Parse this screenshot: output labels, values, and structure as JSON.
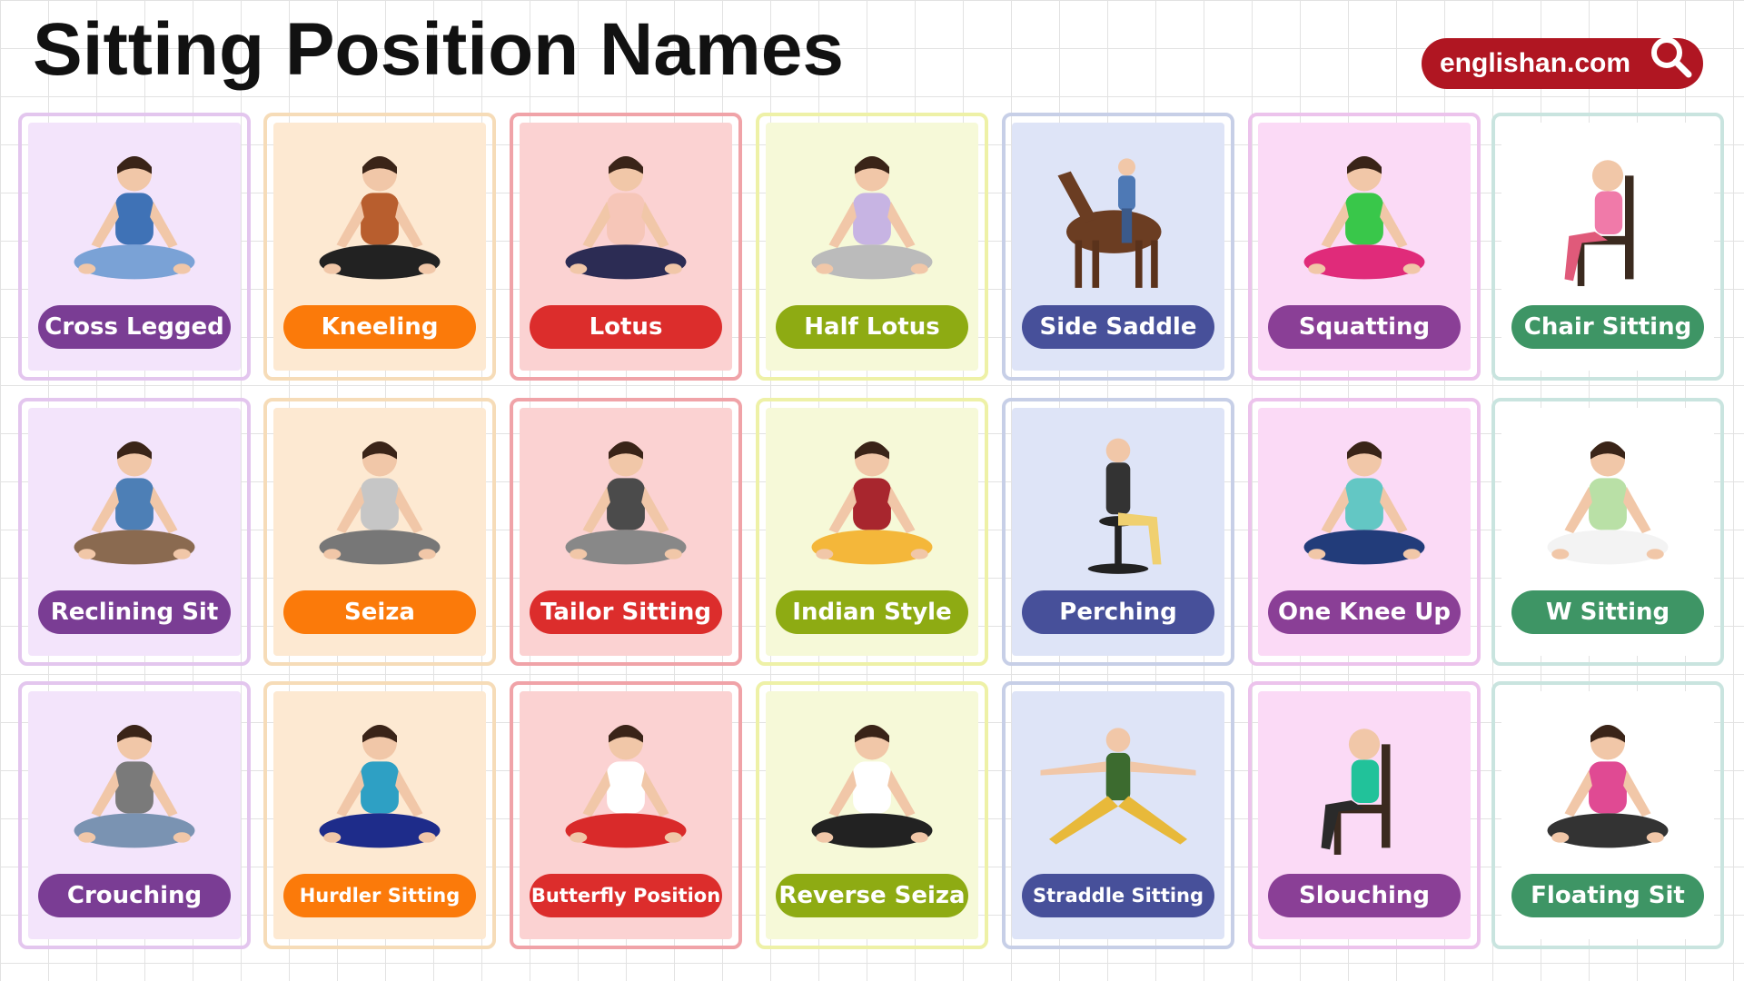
{
  "title": "Sitting Position Names",
  "brand": {
    "label": "englishan.com",
    "icon": "search-icon"
  },
  "themes": {
    "purple": {
      "border": "#e3c6ee",
      "bg": "#f3e4fb",
      "pill": "#7a3d94"
    },
    "orange": {
      "border": "#f6dcb8",
      "bg": "#fde9d2",
      "pill": "#fb7a0a"
    },
    "red": {
      "border": "#f0a3a8",
      "bg": "#fbd2d2",
      "pill": "#dc2d2c"
    },
    "lime": {
      "border": "#eef1a7",
      "bg": "#f6f9d8",
      "pill": "#8eab13"
    },
    "blue": {
      "border": "#c7cfe7",
      "bg": "#dee4f7",
      "pill": "#47509a"
    },
    "pink": {
      "border": "#ecc3ec",
      "bg": "#fbdaf6",
      "pill": "#8a3f96"
    },
    "green": {
      "border": "#c9e4df",
      "bg": "#ffffff",
      "pill": "#3e9565"
    }
  },
  "cards": [
    {
      "label": "Cross Legged",
      "theme": "purple",
      "icon": "cross-legged-figure-icon"
    },
    {
      "label": "Kneeling",
      "theme": "orange",
      "icon": "kneeling-figure-icon"
    },
    {
      "label": "Lotus",
      "theme": "red",
      "icon": "lotus-figure-icon"
    },
    {
      "label": "Half Lotus",
      "theme": "lime",
      "icon": "half-lotus-figure-icon"
    },
    {
      "label": "Side Saddle",
      "theme": "blue",
      "icon": "horse-rider-icon"
    },
    {
      "label": "Squatting",
      "theme": "pink",
      "icon": "squatting-figure-icon"
    },
    {
      "label": "Chair Sitting",
      "theme": "green",
      "icon": "chair-sitting-figure-icon"
    },
    {
      "label": "Reclining Sit",
      "theme": "purple",
      "icon": "reclining-figure-icon"
    },
    {
      "label": "Seiza",
      "theme": "orange",
      "icon": "seiza-figure-icon"
    },
    {
      "label": "Tailor Sitting",
      "theme": "red",
      "icon": "tailor-sitting-figure-icon"
    },
    {
      "label": "Indian Style",
      "theme": "lime",
      "icon": "indian-style-figure-icon"
    },
    {
      "label": "Perching",
      "theme": "blue",
      "icon": "perching-figure-icon"
    },
    {
      "label": "One Knee Up",
      "theme": "pink",
      "icon": "one-knee-up-figure-icon"
    },
    {
      "label": "W Sitting",
      "theme": "green",
      "icon": "w-sitting-figure-icon"
    },
    {
      "label": "Crouching",
      "theme": "purple",
      "icon": "crouching-figure-icon"
    },
    {
      "label": "Hurdler Sitting",
      "theme": "orange",
      "icon": "hurdler-sitting-figure-icon"
    },
    {
      "label": "Butterfly Position",
      "theme": "red",
      "icon": "butterfly-position-figure-icon"
    },
    {
      "label": "Reverse Seiza",
      "theme": "lime",
      "icon": "reverse-seiza-figure-icon"
    },
    {
      "label": "Straddle Sitting",
      "theme": "blue",
      "icon": "straddle-sitting-figure-icon"
    },
    {
      "label": "Slouching",
      "theme": "pink",
      "icon": "slouching-figure-icon"
    },
    {
      "label": "Floating Sit",
      "theme": "green",
      "icon": "floating-sit-figure-icon"
    }
  ]
}
